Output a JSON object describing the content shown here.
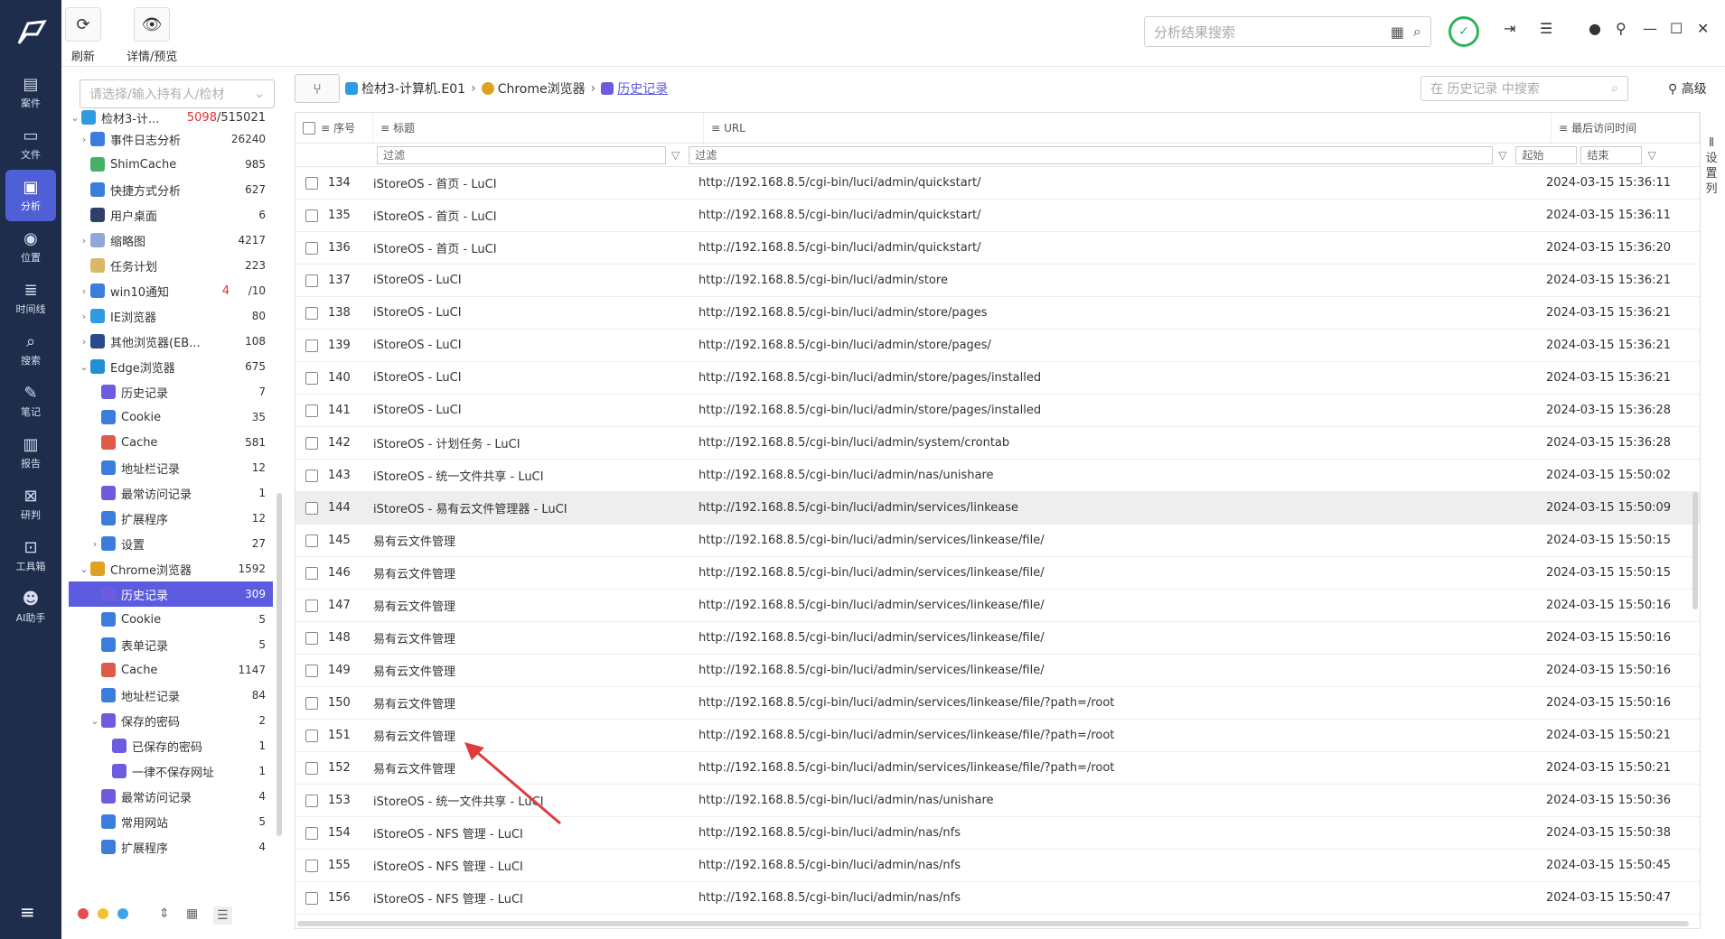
{
  "rail": {
    "items": [
      {
        "label": "案件",
        "icon": "clipboard-icon"
      },
      {
        "label": "文件",
        "icon": "file-icon"
      },
      {
        "label": "分析",
        "icon": "monitor-icon",
        "active": true
      },
      {
        "label": "位置",
        "icon": "location-icon"
      },
      {
        "label": "时间线",
        "icon": "timeline-icon"
      },
      {
        "label": "搜索",
        "icon": "search-icon"
      },
      {
        "label": "笔记",
        "icon": "note-icon"
      },
      {
        "label": "报告",
        "icon": "report-icon"
      },
      {
        "label": "研判",
        "icon": "judge-icon"
      },
      {
        "label": "工具箱",
        "icon": "toolbox-icon"
      },
      {
        "label": "AI助手",
        "icon": "robot-icon"
      }
    ]
  },
  "toolbar": {
    "refresh_label": "刷新",
    "detail_label": "详情/预览",
    "search_placeholder": "分析结果搜索"
  },
  "tree": {
    "select_placeholder": "请选择/输入持有人/检材",
    "root": {
      "label": "检材3-计...",
      "count_a": "5098",
      "count_b": "/515021"
    },
    "items": [
      {
        "label": "事件日志分析",
        "count": "26240",
        "indent": 1,
        "arrow": "›",
        "color": "#3b7ddd"
      },
      {
        "label": "ShimCache",
        "count": "985",
        "indent": 1,
        "arrow": "",
        "color": "#46b06b"
      },
      {
        "label": "快捷方式分析",
        "count": "627",
        "indent": 1,
        "arrow": "",
        "color": "#3b7ddd"
      },
      {
        "label": "用户桌面",
        "count": "6",
        "indent": 1,
        "arrow": "",
        "color": "#2f3f6a"
      },
      {
        "label": "缩略图",
        "count": "4217",
        "indent": 1,
        "arrow": "›",
        "color": "#8fa8d8"
      },
      {
        "label": "任务计划",
        "count": "223",
        "indent": 1,
        "arrow": "",
        "color": "#d9b86a"
      },
      {
        "label": "win10通知",
        "count_red": "4",
        "count": "/10",
        "indent": 1,
        "arrow": "›",
        "color": "#3b7ddd"
      },
      {
        "label": "IE浏览器",
        "count": "80",
        "indent": 1,
        "arrow": "›",
        "color": "#2f9ae0"
      },
      {
        "label": "其他浏览器(EB...",
        "count": "108",
        "indent": 1,
        "arrow": "›",
        "color": "#2a4a8a"
      },
      {
        "label": "Edge浏览器",
        "count": "675",
        "indent": 1,
        "arrow": "⌄",
        "color": "#1f8fd6"
      },
      {
        "label": "历史记录",
        "count": "7",
        "indent": 2,
        "arrow": "",
        "color": "#6d5ce0"
      },
      {
        "label": "Cookie",
        "count": "35",
        "indent": 2,
        "arrow": "",
        "color": "#3b7ddd"
      },
      {
        "label": "Cache",
        "count": "581",
        "indent": 2,
        "arrow": "",
        "color": "#e05a4a"
      },
      {
        "label": "地址栏记录",
        "count": "12",
        "indent": 2,
        "arrow": "",
        "color": "#3b7ddd"
      },
      {
        "label": "最常访问记录",
        "count": "1",
        "indent": 2,
        "arrow": "",
        "color": "#6d5ce0"
      },
      {
        "label": "扩展程序",
        "count": "12",
        "indent": 2,
        "arrow": "",
        "color": "#3b7ddd"
      },
      {
        "label": "设置",
        "count": "27",
        "indent": 2,
        "arrow": "›",
        "color": "#3b7ddd"
      },
      {
        "label": "Chrome浏览器",
        "count": "1592",
        "indent": 1,
        "arrow": "⌄",
        "color": "#e0a020"
      },
      {
        "label": "历史记录",
        "count": "309",
        "indent": 2,
        "arrow": "",
        "color": "#6d5ce0",
        "selected": true
      },
      {
        "label": "Cookie",
        "count": "5",
        "indent": 2,
        "arrow": "",
        "color": "#3b7ddd"
      },
      {
        "label": "表单记录",
        "count": "5",
        "indent": 2,
        "arrow": "",
        "color": "#3b7ddd"
      },
      {
        "label": "Cache",
        "count": "1147",
        "indent": 2,
        "arrow": "",
        "color": "#e05a4a"
      },
      {
        "label": "地址栏记录",
        "count": "84",
        "indent": 2,
        "arrow": "",
        "color": "#3b7ddd"
      },
      {
        "label": "保存的密码",
        "count": "2",
        "indent": 2,
        "arrow": "⌄",
        "color": "#6d5ce0"
      },
      {
        "label": "已保存的密码",
        "count": "1",
        "indent": 3,
        "arrow": "",
        "color": "#6d5ce0"
      },
      {
        "label": "一律不保存网址",
        "count": "1",
        "indent": 3,
        "arrow": "",
        "color": "#6d5ce0"
      },
      {
        "label": "最常访问记录",
        "count": "4",
        "indent": 2,
        "arrow": "",
        "color": "#6d5ce0"
      },
      {
        "label": "常用网站",
        "count": "5",
        "indent": 2,
        "arrow": "",
        "color": "#3b7ddd"
      },
      {
        "label": "扩展程序",
        "count": "4",
        "indent": 2,
        "arrow": "",
        "color": "#3b7ddd"
      }
    ],
    "footer_dots": [
      "#e84b4b",
      "#f2c230",
      "#3ba6e8"
    ]
  },
  "breadcrumb": {
    "items": [
      "检材3-计算机.E01",
      "Chrome浏览器",
      "历史记录"
    ],
    "search_placeholder": "在 历史记录 中搜索",
    "advanced_label": "高级"
  },
  "grid": {
    "headers": {
      "no": "序号",
      "title": "标题",
      "url": "URL",
      "time": "最后访问时间"
    },
    "filter_placeholder": "过滤",
    "start_label": "起始",
    "end_label": "结束",
    "rows": [
      {
        "no": "134",
        "title": "iStoreOS - 首页 - LuCI",
        "url": "http://192.168.8.5/cgi-bin/luci/admin/quickstart/",
        "time": "2024-03-15 15:36:11"
      },
      {
        "no": "135",
        "title": "iStoreOS - 首页 - LuCI",
        "url": "http://192.168.8.5/cgi-bin/luci/admin/quickstart/",
        "time": "2024-03-15 15:36:11"
      },
      {
        "no": "136",
        "title": "iStoreOS - 首页 - LuCI",
        "url": "http://192.168.8.5/cgi-bin/luci/admin/quickstart/",
        "time": "2024-03-15 15:36:20"
      },
      {
        "no": "137",
        "title": "iStoreOS - LuCI",
        "url": "http://192.168.8.5/cgi-bin/luci/admin/store",
        "time": "2024-03-15 15:36:21"
      },
      {
        "no": "138",
        "title": "iStoreOS - LuCI",
        "url": "http://192.168.8.5/cgi-bin/luci/admin/store/pages",
        "time": "2024-03-15 15:36:21"
      },
      {
        "no": "139",
        "title": "iStoreOS - LuCI",
        "url": "http://192.168.8.5/cgi-bin/luci/admin/store/pages/",
        "time": "2024-03-15 15:36:21"
      },
      {
        "no": "140",
        "title": "iStoreOS - LuCI",
        "url": "http://192.168.8.5/cgi-bin/luci/admin/store/pages/installed",
        "time": "2024-03-15 15:36:21"
      },
      {
        "no": "141",
        "title": "iStoreOS - LuCI",
        "url": "http://192.168.8.5/cgi-bin/luci/admin/store/pages/installed",
        "time": "2024-03-15 15:36:28"
      },
      {
        "no": "142",
        "title": "iStoreOS - 计划任务 - LuCI",
        "url": "http://192.168.8.5/cgi-bin/luci/admin/system/crontab",
        "time": "2024-03-15 15:36:28"
      },
      {
        "no": "143",
        "title": "iStoreOS - 统一文件共享 - LuCI",
        "url": "http://192.168.8.5/cgi-bin/luci/admin/nas/unishare",
        "time": "2024-03-15 15:50:02"
      },
      {
        "no": "144",
        "title": "iStoreOS - 易有云文件管理器 - LuCI",
        "url": "http://192.168.8.5/cgi-bin/luci/admin/services/linkease",
        "time": "2024-03-15 15:50:09",
        "highlight": true
      },
      {
        "no": "145",
        "title": "易有云文件管理",
        "url": "http://192.168.8.5/cgi-bin/luci/admin/services/linkease/file/",
        "time": "2024-03-15 15:50:15"
      },
      {
        "no": "146",
        "title": "易有云文件管理",
        "url": "http://192.168.8.5/cgi-bin/luci/admin/services/linkease/file/",
        "time": "2024-03-15 15:50:15"
      },
      {
        "no": "147",
        "title": "易有云文件管理",
        "url": "http://192.168.8.5/cgi-bin/luci/admin/services/linkease/file/",
        "time": "2024-03-15 15:50:16"
      },
      {
        "no": "148",
        "title": "易有云文件管理",
        "url": "http://192.168.8.5/cgi-bin/luci/admin/services/linkease/file/",
        "time": "2024-03-15 15:50:16"
      },
      {
        "no": "149",
        "title": "易有云文件管理",
        "url": "http://192.168.8.5/cgi-bin/luci/admin/services/linkease/file/",
        "time": "2024-03-15 15:50:16"
      },
      {
        "no": "150",
        "title": "易有云文件管理",
        "url": "http://192.168.8.5/cgi-bin/luci/admin/services/linkease/file/?path=/root",
        "time": "2024-03-15 15:50:16"
      },
      {
        "no": "151",
        "title": "易有云文件管理",
        "url": "http://192.168.8.5/cgi-bin/luci/admin/services/linkease/file/?path=/root",
        "time": "2024-03-15 15:50:21"
      },
      {
        "no": "152",
        "title": "易有云文件管理",
        "url": "http://192.168.8.5/cgi-bin/luci/admin/services/linkease/file/?path=/root",
        "time": "2024-03-15 15:50:21"
      },
      {
        "no": "153",
        "title": "iStoreOS - 统一文件共享 - LuCI",
        "url": "http://192.168.8.5/cgi-bin/luci/admin/nas/unishare",
        "time": "2024-03-15 15:50:36"
      },
      {
        "no": "154",
        "title": "iStoreOS - NFS 管理 - LuCI",
        "url": "http://192.168.8.5/cgi-bin/luci/admin/nas/nfs",
        "time": "2024-03-15 15:50:38"
      },
      {
        "no": "155",
        "title": "iStoreOS - NFS 管理 - LuCI",
        "url": "http://192.168.8.5/cgi-bin/luci/admin/nas/nfs",
        "time": "2024-03-15 15:50:45"
      },
      {
        "no": "156",
        "title": "iStoreOS - NFS 管理 - LuCI",
        "url": "http://192.168.8.5/cgi-bin/luci/admin/nas/nfs",
        "time": "2024-03-15 15:50:47"
      }
    ]
  },
  "side_setting": {
    "label": "设置列"
  },
  "colors": {
    "accent": "#5b5ce0",
    "rail_bg": "#1f2d4d",
    "annotation_arrow": "#e03c3c"
  }
}
